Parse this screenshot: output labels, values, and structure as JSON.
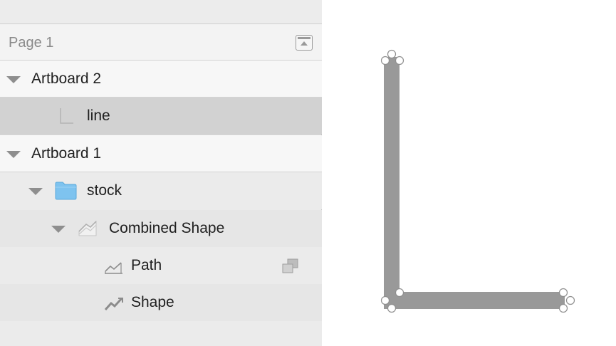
{
  "page": {
    "title": "Page 1",
    "collapse_icon": "collapse-panel-icon"
  },
  "layers": {
    "artboard_2": {
      "label": "Artboard 2",
      "icon": "disclosure-triangle-icon"
    },
    "line": {
      "label": "line",
      "icon": "line-layer-icon"
    },
    "artboard_1": {
      "label": "Artboard 1",
      "icon": "disclosure-triangle-icon"
    },
    "stock": {
      "label": "stock",
      "icon": "folder-icon"
    },
    "combined_shape": {
      "label": "Combined Shape",
      "icon": "combined-shape-icon"
    },
    "path": {
      "label": "Path",
      "icon": "path-icon",
      "badge_icon": "boolean-union-icon"
    },
    "shape": {
      "label": "Shape",
      "icon": "shape-icon"
    }
  },
  "canvas": {
    "selected_layer": "line",
    "stroke_color": "#999999",
    "handle_color": "#ffffff",
    "folder_color": "#7ec3ef"
  }
}
